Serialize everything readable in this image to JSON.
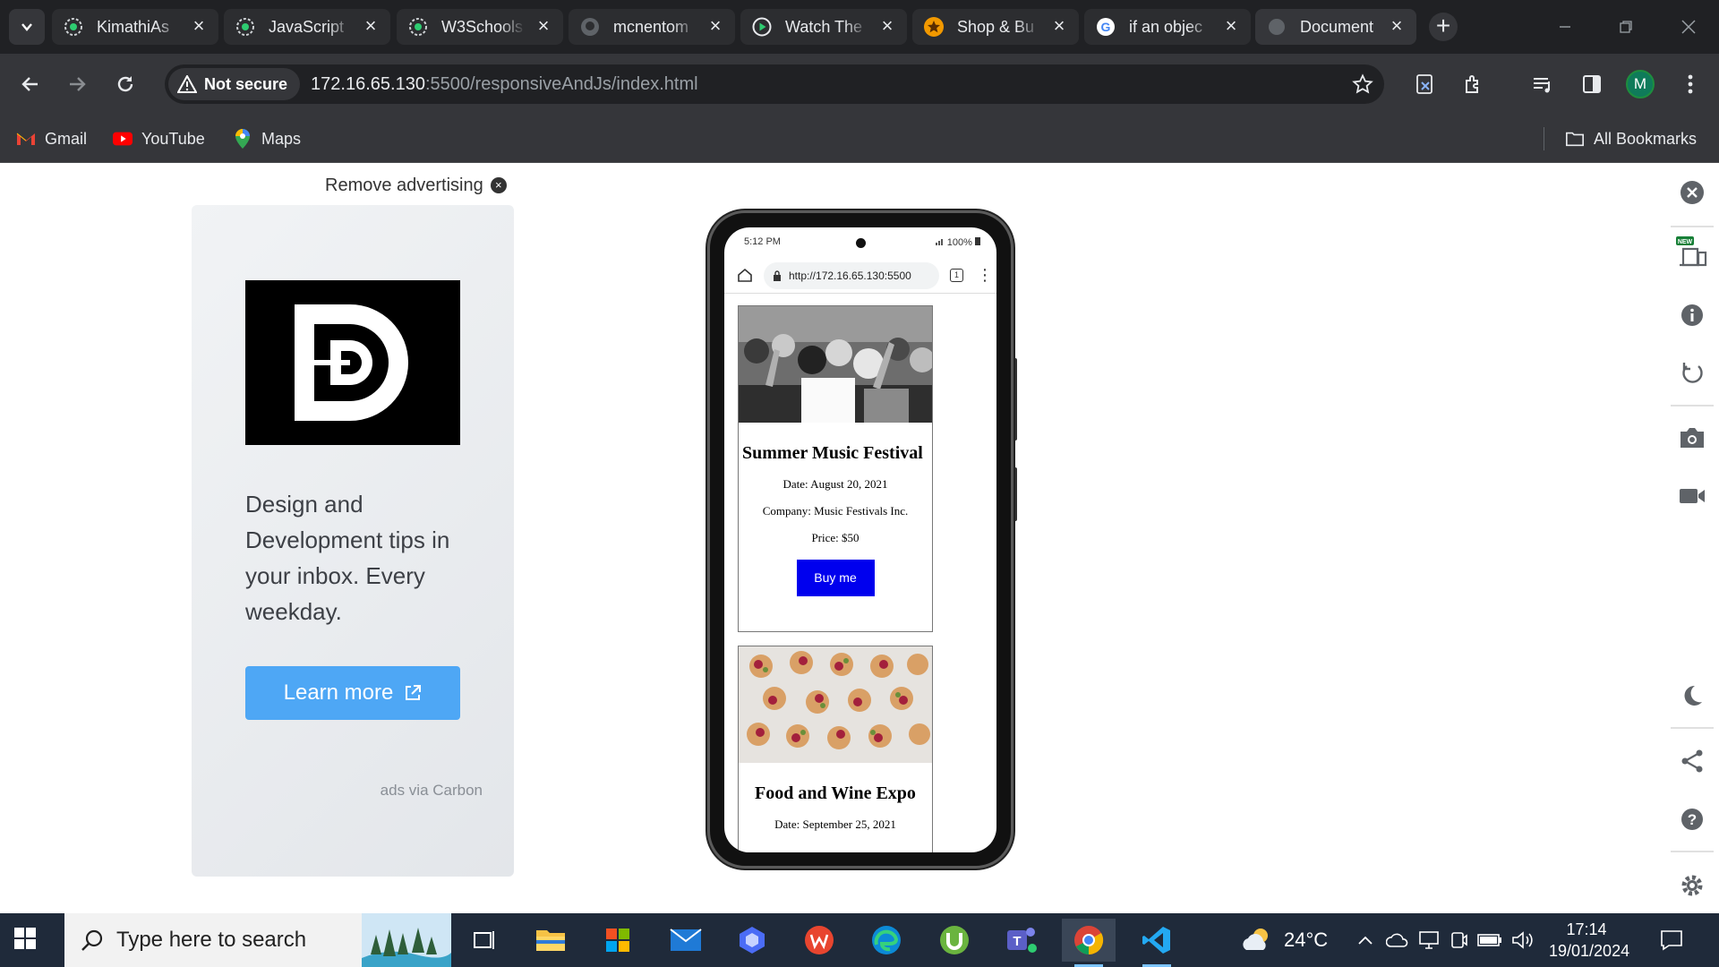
{
  "browser": {
    "tabs": [
      {
        "title": "KimathiAs",
        "favicon": "gear-green-icon"
      },
      {
        "title": "JavaScript",
        "favicon": "gear-green-icon"
      },
      {
        "title": "W3Schools",
        "favicon": "gear-green-icon"
      },
      {
        "title": "mcnentom",
        "favicon": "github-icon"
      },
      {
        "title": "Watch The",
        "favicon": "play-icon"
      },
      {
        "title": "Shop & Bu",
        "favicon": "star-icon"
      },
      {
        "title": "if an objec",
        "favicon": "google-icon"
      },
      {
        "title": "Document",
        "favicon": "globe-icon",
        "active": true
      }
    ],
    "security_label": "Not secure",
    "url_host": "172.16.65.130",
    "url_rest": ":5500/responsiveAndJs/index.html",
    "profile_initial": "M",
    "bookmarks": [
      {
        "label": "Gmail",
        "icon": "gmail-icon"
      },
      {
        "label": "YouTube",
        "icon": "youtube-icon"
      },
      {
        "label": "Maps",
        "icon": "maps-pin-icon"
      }
    ],
    "all_bookmarks": "All Bookmarks"
  },
  "ad": {
    "remove_label": "Remove advertising",
    "text": "Design and Development tips in your inbox. Every weekday.",
    "button": "Learn more",
    "via": "ads via Carbon"
  },
  "phone": {
    "time": "5:12 PM",
    "battery": "100%",
    "url": "http://172.16.65.130:5500",
    "tab_count": "1",
    "events": [
      {
        "title": "Summer Music Festival",
        "date": "Date: August 20, 2021",
        "company": "Company: Music Festivals Inc.",
        "price": "Price: $50",
        "button": "Buy me"
      },
      {
        "title": "Food and Wine Expo",
        "date": "Date: September 25, 2021"
      }
    ]
  },
  "taskbar": {
    "search_placeholder": "Type here to search",
    "weather": "24°C",
    "time": "17:14",
    "date": "19/01/2024"
  },
  "colors": {
    "buy_button": "#0000ee",
    "learn_more": "#4ea7f5",
    "chrome_dark": "#202124"
  }
}
